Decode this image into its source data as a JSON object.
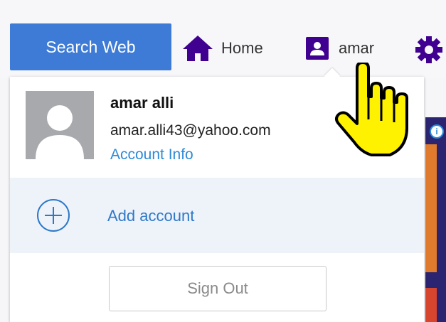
{
  "header": {
    "search_label": "Search Web",
    "home_label": "Home",
    "user_label": "amar"
  },
  "account_menu": {
    "name": "amar alli",
    "email": "amar.alli43@yahoo.com",
    "account_info_label": "Account Info",
    "add_account_label": "Add account",
    "sign_out_label": "Sign Out"
  },
  "colors": {
    "search_button": "#3d7bd6",
    "brand_purple": "#400090",
    "link_blue": "#2d8ad6",
    "add_row_bg": "#eef3fa"
  },
  "icons": [
    "home-icon",
    "user-icon",
    "gear-icon",
    "avatar-placeholder",
    "plus-circle-icon",
    "pointer-hand-cursor",
    "info-icon"
  ]
}
